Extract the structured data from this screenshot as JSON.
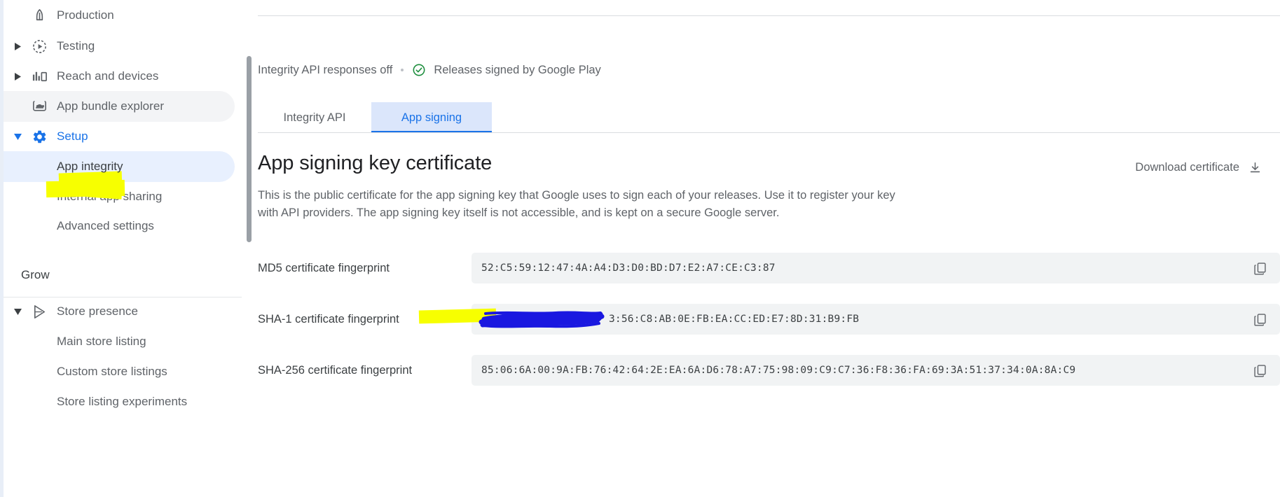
{
  "sidebar": {
    "items": [
      {
        "label": "Production",
        "icon": "rocket-icon",
        "type": "main",
        "expandable": false,
        "expanded": false,
        "state": "default"
      },
      {
        "label": "Testing",
        "icon": "play-circle-icon",
        "type": "main",
        "expandable": true,
        "expanded": false,
        "state": "default"
      },
      {
        "label": "Reach and devices",
        "icon": "bar-chart-icon",
        "type": "main",
        "expandable": true,
        "expanded": false,
        "state": "default"
      },
      {
        "label": "App bundle explorer",
        "icon": "android-box-icon",
        "type": "main",
        "expandable": false,
        "expanded": false,
        "state": "hover"
      },
      {
        "label": "Setup",
        "icon": "gear-icon",
        "type": "main",
        "expandable": true,
        "expanded": true,
        "state": "active"
      },
      {
        "label": "App integrity",
        "icon": "",
        "type": "sub",
        "expandable": false,
        "expanded": false,
        "state": "selected"
      },
      {
        "label": "Internal app sharing",
        "icon": "",
        "type": "sub",
        "expandable": false,
        "expanded": false,
        "state": "default"
      },
      {
        "label": "Advanced settings",
        "icon": "",
        "type": "sub",
        "expandable": false,
        "expanded": false,
        "state": "default"
      }
    ],
    "grow_section_title": "Grow",
    "grow_items": [
      {
        "label": "Store presence",
        "icon": "google-play-icon",
        "type": "main",
        "expandable": true,
        "expanded": true
      },
      {
        "label": "Main store listing",
        "icon": "",
        "type": "sub",
        "expandable": false,
        "expanded": false
      },
      {
        "label": "Custom store listings",
        "icon": "",
        "type": "sub",
        "expandable": false,
        "expanded": false
      },
      {
        "label": "Store listing experiments",
        "icon": "",
        "type": "sub",
        "expandable": false,
        "expanded": false
      }
    ]
  },
  "status": {
    "integrity_text": "Integrity API responses off",
    "signed_text": "Releases signed by Google Play",
    "check_icon": "check-circle-icon",
    "check_color": "#1e8e3e"
  },
  "tabs": [
    {
      "label": "Integrity API",
      "active": false
    },
    {
      "label": "App signing",
      "active": true
    }
  ],
  "content": {
    "title": "App signing key certificate",
    "download_label": "Download certificate",
    "download_icon": "download-icon",
    "description": "This is the public certificate for the app signing key that Google uses to sign each of your releases. Use it to register your key with API providers. The app signing key itself is not accessible, and is kept on a secure Google server."
  },
  "fingerprints": [
    {
      "label": "MD5 certificate fingerprint",
      "value": "52:C5:59:12:47:4A:A4:D3:D0:BD:D7:E2:A7:CE:C3:87",
      "copy_icon": "copy-icon",
      "redacted": false,
      "highlighted": false
    },
    {
      "label": "SHA-1 certificate fingerprint",
      "value": "3:56:C8:AB:0E:FB:EA:CC:ED:E7:8D:31:B9:FB",
      "copy_icon": "copy-icon",
      "redacted": true,
      "highlighted": true
    },
    {
      "label": "SHA-256 certificate fingerprint",
      "value": "85:06:6A:00:9A:FB:76:42:64:2E:EA:6A:D6:78:A7:75:98:09:C9:C7:36:F8:36:FA:69:3A:51:37:34:0A:8A:C9",
      "copy_icon": "copy-icon",
      "redacted": false,
      "highlighted": false
    }
  ],
  "annotations": {
    "highlighter_color": "#f7ff00",
    "redaction_color": "#1a18e0"
  }
}
